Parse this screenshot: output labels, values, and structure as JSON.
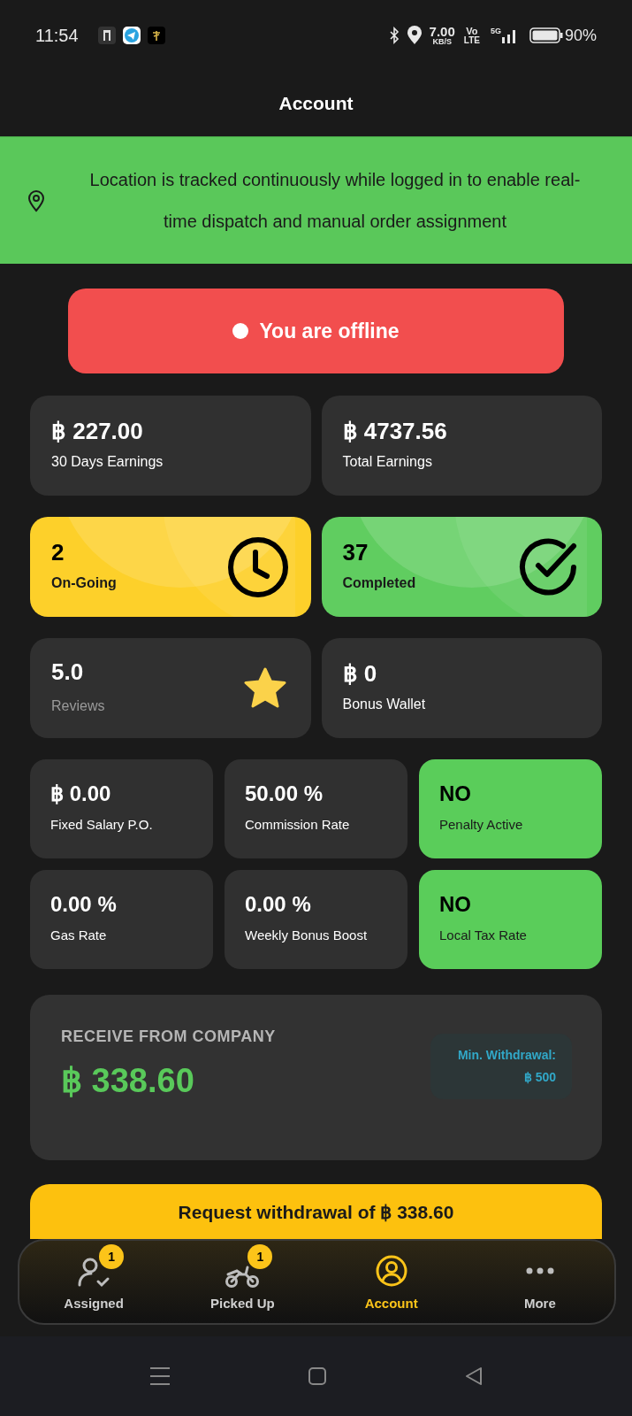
{
  "status_bar": {
    "time": "11:54",
    "speed": "7.00",
    "speed_unit": "KB/S",
    "volte_top": "Vo",
    "volte_bottom": "LTE",
    "network": "5G",
    "battery": "90%"
  },
  "header": {
    "title": "Account"
  },
  "banner": {
    "text": "Location is tracked continuously while logged in to enable real-time dispatch and manual order assignment"
  },
  "status_button": {
    "label": "You are offline",
    "online": false
  },
  "stat_cards": [
    {
      "kind": "plain",
      "value": "฿ 227.00",
      "label": "30 Days Earnings"
    },
    {
      "kind": "plain",
      "value": "฿ 4737.56",
      "label": "Total Earnings"
    },
    {
      "kind": "ongoing",
      "value": "2",
      "label": "On-Going"
    },
    {
      "kind": "completed",
      "value": "37",
      "label": "Completed"
    },
    {
      "kind": "rating",
      "value": "5.0",
      "label": "Reviews"
    },
    {
      "kind": "plain",
      "value": "฿ 0",
      "label": "Bonus Wallet"
    }
  ],
  "small_cards": [
    {
      "kind": "plain",
      "value": "฿ 0.00",
      "label": "Fixed Salary P.O."
    },
    {
      "kind": "plain",
      "value": "50.00 %",
      "label": "Commission Rate"
    },
    {
      "kind": "flag",
      "value": "NO",
      "label": "Penalty Active"
    },
    {
      "kind": "plain",
      "value": "0.00 %",
      "label": "Gas Rate"
    },
    {
      "kind": "plain",
      "value": "0.00 %",
      "label": "Weekly Bonus Boost"
    },
    {
      "kind": "flag",
      "value": "NO",
      "label": "Local Tax Rate"
    }
  ],
  "receive": {
    "label": "RECEIVE FROM COMPANY",
    "amount": "฿ 338.60",
    "min_label": "Min. Withdrawal:",
    "min_amount": "฿ 500"
  },
  "withdraw_button": {
    "label": "Request withdrawal of ฿ 338.60"
  },
  "bottom_nav": [
    {
      "kind": "assigned",
      "label": "Assigned",
      "badge": "1",
      "selected": false
    },
    {
      "kind": "picked",
      "label": "Picked Up",
      "badge": "1",
      "selected": false
    },
    {
      "kind": "account",
      "label": "Account",
      "selected": true
    },
    {
      "kind": "more",
      "label": "More",
      "selected": false
    }
  ]
}
